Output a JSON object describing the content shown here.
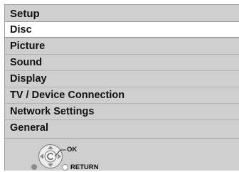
{
  "menu": {
    "title": "Setup",
    "items": [
      {
        "label": "Disc",
        "selected": true
      },
      {
        "label": "Picture",
        "selected": false
      },
      {
        "label": "Sound",
        "selected": false
      },
      {
        "label": "Display",
        "selected": false
      },
      {
        "label": "TV / Device Connection",
        "selected": false
      },
      {
        "label": "Network Settings",
        "selected": false
      },
      {
        "label": "General",
        "selected": false
      }
    ]
  },
  "footer": {
    "ok_label": "OK",
    "return_label": "RETURN",
    "icons": [
      "dpad-icon",
      "return-button-icon"
    ]
  },
  "colors": {
    "panel": "#cfcfcf",
    "selected_row": "#ffffff",
    "text": "#111111"
  }
}
